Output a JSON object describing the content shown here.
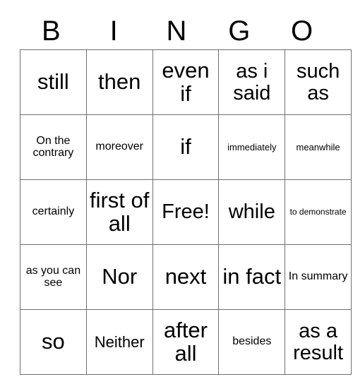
{
  "card": {
    "title_letters": [
      "B",
      "I",
      "N",
      "G",
      "O"
    ],
    "free_space_label": "Free!",
    "rows": [
      [
        {
          "text": "still",
          "size": "fs-xl"
        },
        {
          "text": "then",
          "size": "fs-xl"
        },
        {
          "text": "even if",
          "size": "fs-xl"
        },
        {
          "text": "as i said",
          "size": "fs-lg"
        },
        {
          "text": "such as",
          "size": "fs-lg"
        }
      ],
      [
        {
          "text": "On the contrary",
          "size": "fs-sm"
        },
        {
          "text": "moreover",
          "size": "fs-sm"
        },
        {
          "text": "if",
          "size": "fs-xl"
        },
        {
          "text": "immediately",
          "size": "fs-xs"
        },
        {
          "text": "meanwhile",
          "size": "fs-xs"
        }
      ],
      [
        {
          "text": "certainly",
          "size": "fs-sm"
        },
        {
          "text": "first of all",
          "size": "fs-xl"
        },
        {
          "text": "Free!",
          "size": "fs-lg"
        },
        {
          "text": "while",
          "size": "fs-lg"
        },
        {
          "text": "to demonstrate",
          "size": "fs-xxs"
        }
      ],
      [
        {
          "text": "as you can see",
          "size": "fs-sm"
        },
        {
          "text": "Nor",
          "size": "fs-xl"
        },
        {
          "text": "next",
          "size": "fs-xl"
        },
        {
          "text": "in fact",
          "size": "fs-xl"
        },
        {
          "text": "In summary",
          "size": "fs-sm"
        }
      ],
      [
        {
          "text": "so",
          "size": "fs-xl"
        },
        {
          "text": "Neither",
          "size": "fs-md"
        },
        {
          "text": "after all",
          "size": "fs-xl"
        },
        {
          "text": "besides",
          "size": "fs-sm"
        },
        {
          "text": "as a result",
          "size": "fs-lg"
        }
      ]
    ]
  },
  "colors": {
    "border": "#6f6f6f",
    "text": "#000000",
    "background": "#ffffff"
  }
}
